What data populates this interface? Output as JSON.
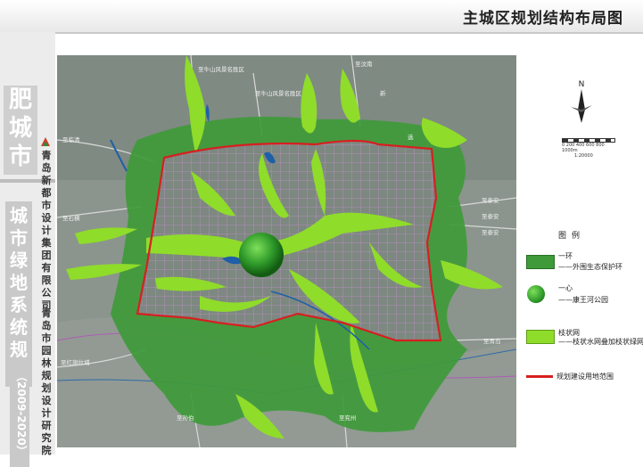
{
  "header": {
    "title": "主城区规划结构布局图"
  },
  "sidebar": {
    "city": "肥城市",
    "plan_title": "城市绿地系统规划",
    "years": "（2009-2020）",
    "org1": "青岛新都市设计集团有限公司",
    "org2": "青岛市园林规划设计研究院"
  },
  "map": {
    "place_labels": [
      "至牛山风景名胜区",
      "至牛山风景名胜区",
      "至临清",
      "至石横",
      "至泰安",
      "至泰安",
      "至泰安",
      "至青岛",
      "至红旗拉埔",
      "至孙伯",
      "至兖州",
      "至汶南",
      "新",
      "选"
    ],
    "colors": {
      "eco_ring": "#3f9a3a",
      "branch_green": "#8fdc2a",
      "boundary": "#d62020",
      "water": "#1e5fa8",
      "base": "#8a948c"
    }
  },
  "compass": {
    "north": "N"
  },
  "scale": {
    "ticks": "0  200  400  600  800  1000m",
    "ratio": "1:20000"
  },
  "legend": {
    "title": "图例",
    "items": [
      {
        "name": "一环",
        "desc": "——外围生态保护环",
        "icon": "eco-ring-swatch"
      },
      {
        "name": "一心",
        "desc": "——康王河公园",
        "icon": "green-core-circle"
      },
      {
        "name": "枝状网",
        "desc": "——枝状水网叠加枝状绿网",
        "icon": "branch-network-swatch"
      },
      {
        "name": "",
        "desc": "规划建设用地范围",
        "icon": "boundary-line"
      }
    ]
  }
}
